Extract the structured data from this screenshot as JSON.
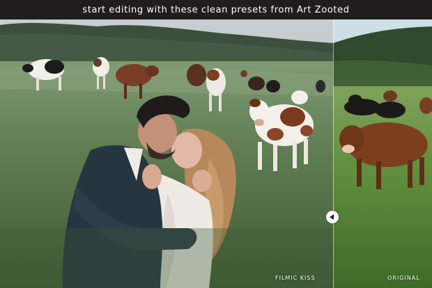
{
  "banner": {
    "text": "start editing with these clean presets from Art Zooted"
  },
  "comparison": {
    "left_label": "FILMIC KISS",
    "right_label": "ORIGINAL",
    "handle_icon": "left-arrow-icon"
  },
  "colors": {
    "banner_bg": "#1f1d1e",
    "banner_text": "#ffffff"
  }
}
